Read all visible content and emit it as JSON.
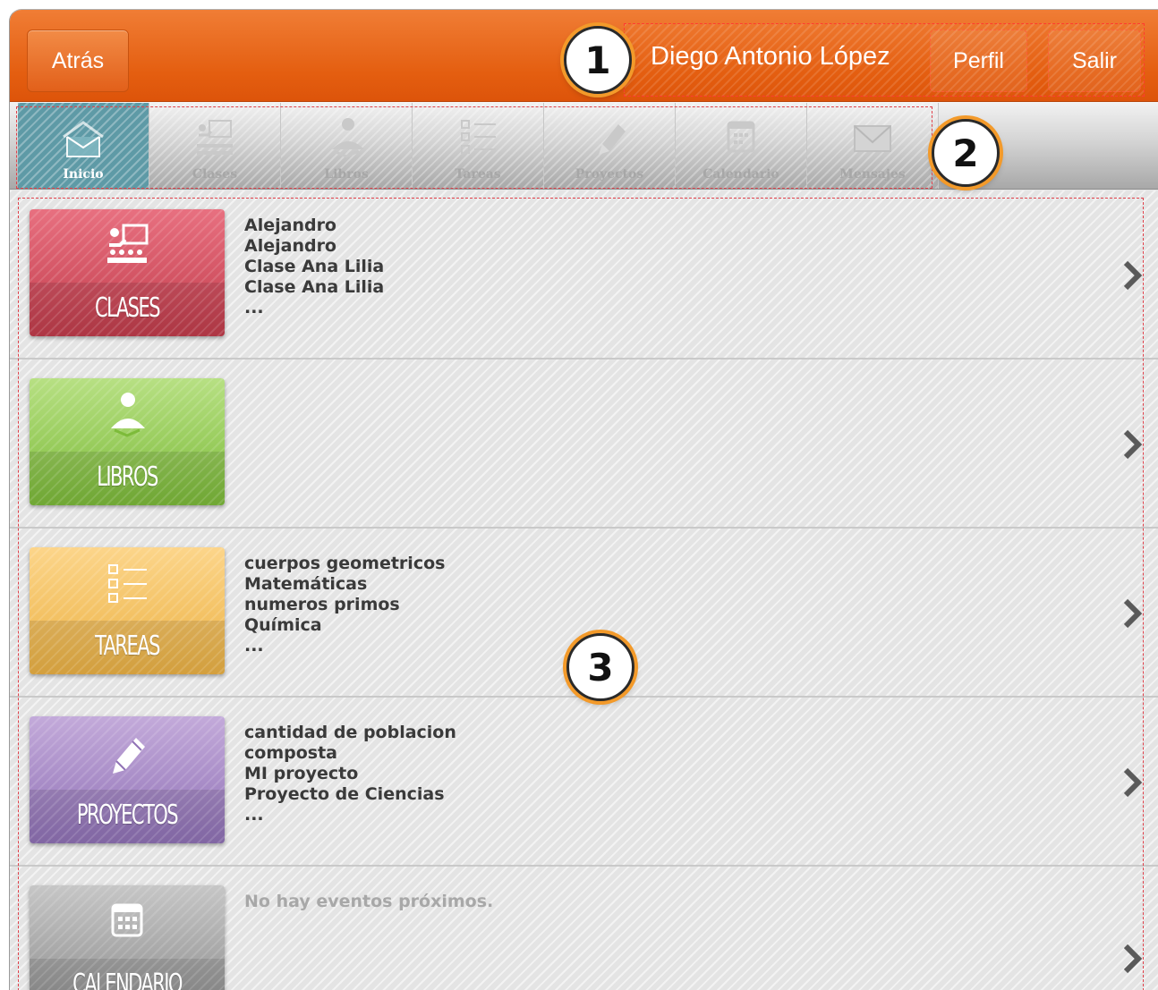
{
  "header": {
    "back_label": "Atrás",
    "user_name": "Diego Antonio López",
    "profile_label": "Perfil",
    "logout_label": "Salir"
  },
  "callouts": [
    "1",
    "2",
    "3"
  ],
  "toolbar": {
    "items": [
      {
        "label": "Inicio",
        "icon": "home-icon",
        "active": true
      },
      {
        "label": "Clases",
        "icon": "classroom-icon"
      },
      {
        "label": "Libros",
        "icon": "reader-icon"
      },
      {
        "label": "Tareas",
        "icon": "checklist-icon"
      },
      {
        "label": "Proyectos",
        "icon": "pencil-icon"
      },
      {
        "label": "Calendario",
        "icon": "calendar-icon"
      },
      {
        "label": "Mensajes",
        "icon": "envelope-icon"
      }
    ]
  },
  "sections": [
    {
      "tile_label": "CLASES",
      "color": "#c94656",
      "icon": "classroom-icon",
      "items": [
        "Alejandro",
        "Alejandro",
        "Clase Ana Lilia",
        "Clase Ana Lilia",
        "..."
      ]
    },
    {
      "tile_label": "LIBROS",
      "color": "#8cc84b",
      "icon": "reader-icon",
      "items": []
    },
    {
      "tile_label": "TAREAS",
      "color": "#f0bb55",
      "icon": "checklist-icon",
      "items": [
        "cuerpos geometricos",
        "Matemáticas",
        "numeros primos",
        "Química",
        "..."
      ]
    },
    {
      "tile_label": "PROYECTOS",
      "color": "#9a7cc0",
      "icon": "pencil-icon",
      "items": [
        "cantidad de poblacion",
        "composta",
        "MI proyecto",
        "Proyecto de Ciencias",
        "..."
      ]
    },
    {
      "tile_label": "CALENDARIO",
      "color": "#9a9a9a",
      "icon": "calendar-icon",
      "items": [
        "No hay eventos próximos."
      ]
    }
  ]
}
